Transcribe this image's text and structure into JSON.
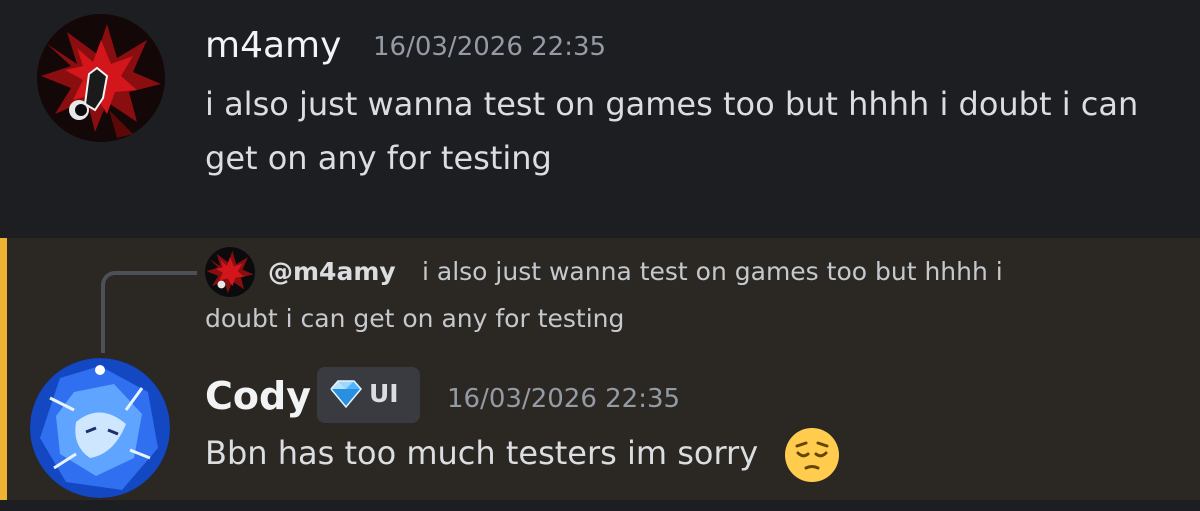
{
  "messages": [
    {
      "author": "m4amy",
      "timestamp": "16/03/2026 22:35",
      "lines": [
        "i also just wanna test on games too but hhhh i doubt i can",
        "get on any for testing"
      ]
    },
    {
      "author": "Cody",
      "role": {
        "label": "UI",
        "icon": "gem-icon",
        "color": "#4fb4ff"
      },
      "timestamp": "16/03/2026 22:35",
      "highlight_color": "#f0b232",
      "reply": {
        "mention": "@m4amy",
        "lines": [
          "i also just wanna test on games too but hhhh i",
          "doubt i can get on any for testing"
        ]
      },
      "lines": [
        "Bbn has too much testers im sorry"
      ],
      "emoji": "pensive-face-emoji"
    }
  ]
}
